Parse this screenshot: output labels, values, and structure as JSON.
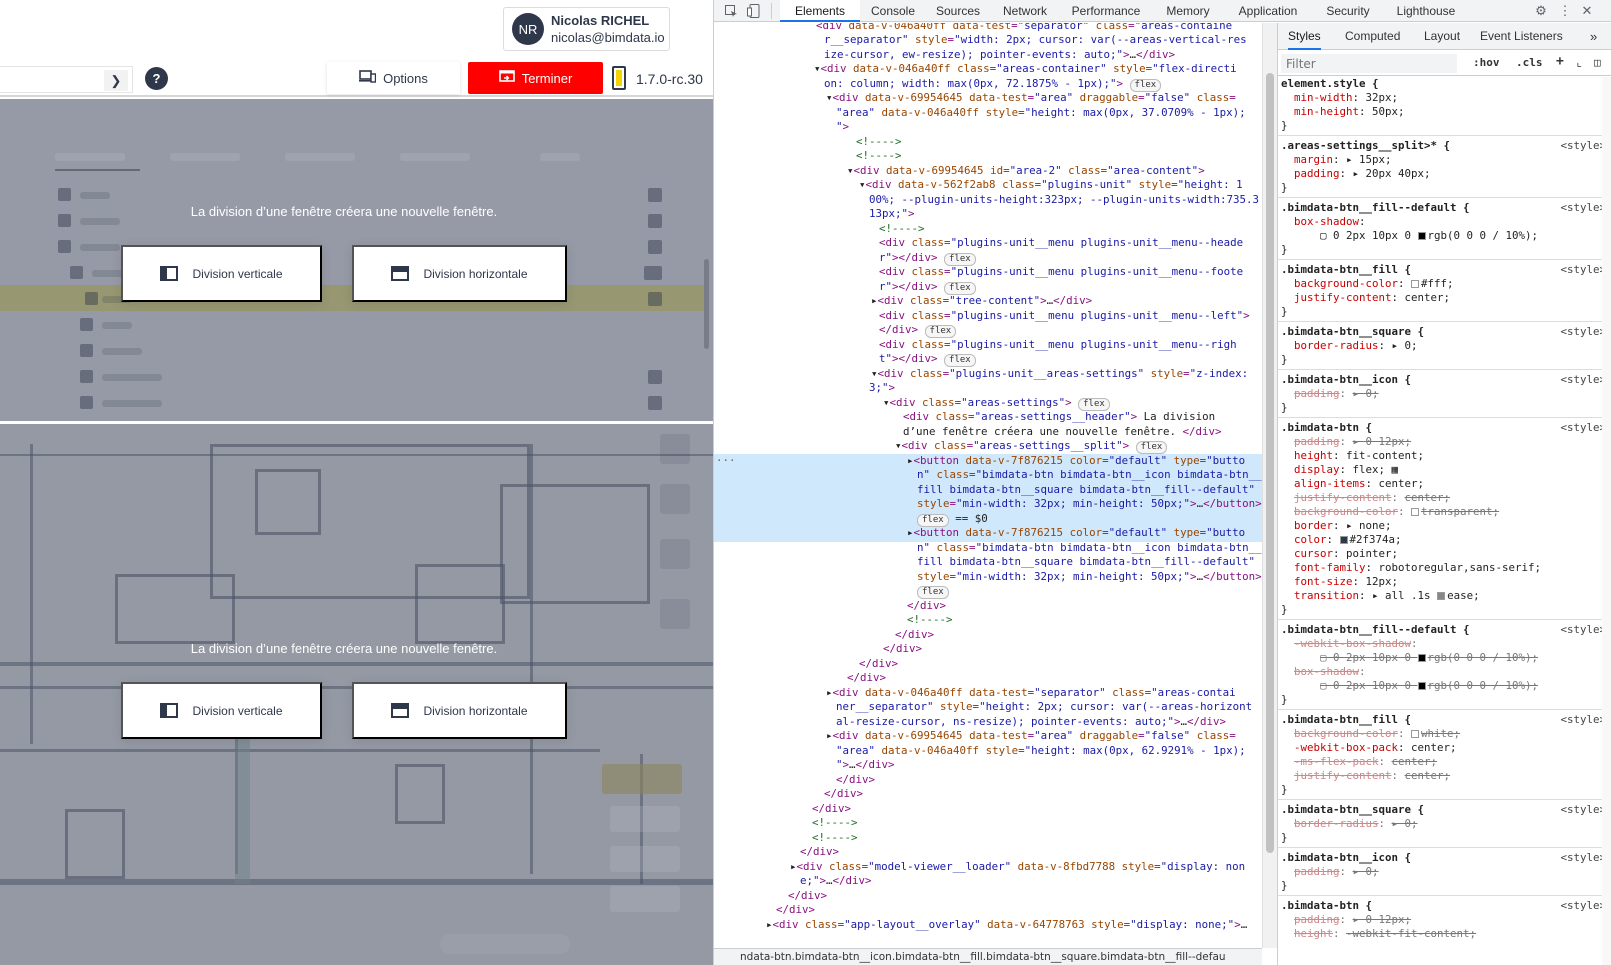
{
  "user": {
    "initials": "NR",
    "name": "Nicolas RICHEL",
    "email": "nicolas@bimdata.io"
  },
  "toolbar": {
    "expand_icon": "chevron-right-icon",
    "help_label": "?",
    "options_label": "Options",
    "terminer_label": "Terminer",
    "version": "1.7.0-rc.30"
  },
  "areas": {
    "top": {
      "header": "La division d’une fenêtre créera une nouvelle fenêtre.",
      "vertical_label": "Division verticale",
      "horizontal_label": "Division horizontale"
    },
    "bottom": {
      "header": "La division d’une fenêtre créera une nouvelle fenêtre.",
      "vertical_label": "Division verticale",
      "horizontal_label": "Division horizontale"
    }
  },
  "devtools": {
    "tabs": [
      "Elements",
      "Console",
      "Sources",
      "Network",
      "Performance",
      "Memory",
      "Application",
      "Security",
      "Lighthouse"
    ],
    "active_tab": "Elements",
    "style_tabs": [
      "Styles",
      "Computed",
      "Layout",
      "Event Listeners"
    ],
    "filter_placeholder": "Filter",
    "hov_label": ":hov",
    "cls_label": ".cls",
    "breadcrumb": "ndata-btn.bimdata-btn__icon.bimdata-btn__fill.bimdata-btn__square.bimdata-btn__fill--defau",
    "dom_lines": [
      {
        "i": 0,
        "h": "<span class=\"tg\">&lt;div</span> <span class=\"an\">data-v-046a40ff</span> <span class=\"an\">data-test</span>=<span class=\"av\">\"separator\"</span> <span class=\"an\">class</span>=<span class=\"av\">\"areas-containe</span>"
      },
      {
        "i": 0,
        "h": "<span class=\"av\">r__separator\"</span> <span class=\"an\">style</span>=<span class=\"av\">\"width: 2px; cursor: var(--areas-vertical-res</span>"
      },
      {
        "i": 0,
        "h": "<span class=\"av\">ize-cursor, ew-resize); pointer-events: auto;\"</span><span class=\"tg\">&gt;</span><span class=\"tx\">…</span><span class=\"tg\">&lt;/div&gt;</span>"
      }
    ]
  },
  "colors": {
    "accent": "#2f374a",
    "danger": "#ff0000",
    "devtools_blue": "#1a73e8"
  }
}
